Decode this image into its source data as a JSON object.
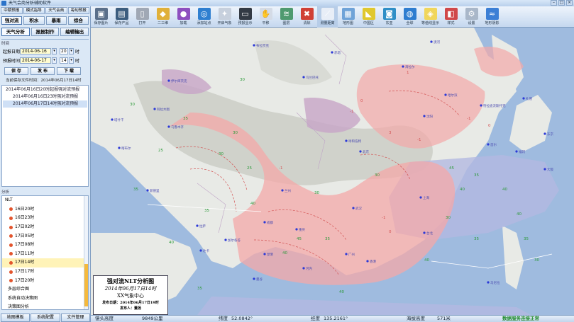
{
  "window": {
    "title": "天气会商分析辅助软件"
  },
  "left_panel": {
    "top_tabs": [
      "中期预报",
      "模式指导",
      "天气会商",
      "每旬预报"
    ],
    "mode_tabs": [
      "强对流",
      "积水",
      "暴雨",
      "综合"
    ],
    "sub_tabs": [
      "天气分析",
      "报报制作",
      "编辑输出"
    ],
    "time_group_label": "时间",
    "start_label": "起报日期",
    "start_date": "2014-06-16",
    "start_hour": "20",
    "hour_unit": "时",
    "forecast_label": "预报时间",
    "forecast_date": "2014-06-17",
    "forecast_hour": "14",
    "btn_save": "保 存",
    "btn_publish": "发 布",
    "btn_next": "下 载",
    "saved_line": "当前保存文件时间：2014年06月17日14时",
    "files": [
      {
        "text": "2014年06月16日20时起报强对流预报"
      },
      {
        "text": "2014年06月16日23时强对流预报"
      },
      {
        "text": "2014年06月17日14时强对流预报"
      }
    ],
    "analysis_label": "分析",
    "tree": [
      {
        "text": "NLT"
      },
      {
        "text": "16日20时",
        "color": "#e3542c"
      },
      {
        "text": "16日23时",
        "color": "#e3542c"
      },
      {
        "text": "17日02时",
        "color": "#e3542c"
      },
      {
        "text": "17日05时",
        "color": "#e3542c"
      },
      {
        "text": "17日08时",
        "color": "#e3542c"
      },
      {
        "text": "17日11时",
        "color": "#e3542c"
      },
      {
        "text": "17日14时",
        "color": "#e3542c"
      },
      {
        "text": "17日17时",
        "color": "#e3542c"
      },
      {
        "text": "17日20时",
        "color": "#e3542c"
      },
      {
        "text": "多层综合图"
      },
      {
        "text": "系统自动决策图"
      },
      {
        "text": "决策图分析"
      }
    ],
    "bottom_tabs": [
      "地图模板",
      "系统配置",
      "文件管理"
    ]
  },
  "toolbar": [
    {
      "label": "保存图片",
      "icon": "save-image-icon",
      "color": "#5a6f8a",
      "glyph": "▣"
    },
    {
      "label": "保存产品",
      "icon": "save-product-icon",
      "color": "#3c5d7e",
      "glyph": "▤"
    },
    {
      "label": "打开",
      "icon": "open-icon",
      "color": "#a0a8b5",
      "glyph": "▯"
    },
    {
      "label": "二三维",
      "icon": "2d3d-icon",
      "color": "#e0b03a",
      "glyph": "◆"
    },
    {
      "label": "加载",
      "icon": "load-icon",
      "color": "#8e4fbf",
      "glyph": "●"
    },
    {
      "label": "添加站点",
      "icon": "globe-icon",
      "color": "#2f7fd0",
      "glyph": "◎"
    },
    {
      "label": "开启气象",
      "icon": "bulb-icon",
      "color": "#c7d0dd",
      "glyph": "✦"
    },
    {
      "label": "预报显示",
      "icon": "monitor-icon",
      "color": "#333a44",
      "glyph": "▭"
    },
    {
      "label": "平移",
      "icon": "hand-icon",
      "color": "#d4dbe6",
      "glyph": "✋"
    },
    {
      "label": "图层",
      "icon": "layers-icon",
      "color": "#4f9a6f",
      "glyph": "≋"
    },
    {
      "label": "清除",
      "icon": "delete-icon",
      "color": "#d04035",
      "glyph": "✖"
    },
    {
      "label": "测量距离",
      "icon": "measure-icon",
      "color": "#e8eef7",
      "glyph": "⟋"
    },
    {
      "label": "地形图",
      "icon": "terrain-icon",
      "color": "#6fa3d8",
      "glyph": "▦"
    },
    {
      "label": "中国区",
      "icon": "china-region-icon",
      "color": "#e0c82e",
      "glyph": "◣"
    },
    {
      "label": "东亚",
      "icon": "east-asia-icon",
      "color": "#2f8fc7",
      "glyph": "◙"
    },
    {
      "label": "全球",
      "icon": "world-icon",
      "color": "#2e7dd0",
      "glyph": "◍"
    },
    {
      "label": "等值线显示",
      "icon": "contour-icon",
      "color": "#f0d65c",
      "glyph": "◈"
    },
    {
      "label": "样式",
      "icon": "style-icon",
      "color": "#d0484a",
      "glyph": "◧"
    },
    {
      "label": "设置",
      "icon": "settings-icon",
      "color": "#a9b7c9",
      "glyph": "⚙"
    },
    {
      "label": "地形阴影",
      "icon": "shadow-icon",
      "color": "#3c7fd5",
      "glyph": "≈"
    }
  ],
  "map": {
    "station_labels": [
      "伊尔库茨克",
      "乌兰巴托",
      "北京",
      "上海",
      "东京",
      "首尔",
      "沈阳",
      "哈尔滨",
      "呼和浩特",
      "兰州",
      "成都",
      "重庆",
      "武汉",
      "广州",
      "香港",
      "昆明",
      "拉萨",
      "乌鲁木齐",
      "台北",
      "马尼拉",
      "河内",
      "曼谷",
      "达卡",
      "加尔各答",
      "新德里",
      "喀布尔",
      "阿拉木图",
      "塔什干",
      "布拉茨克",
      "赤塔",
      "海拉尔",
      "漠河",
      "符拉迪沃斯托克",
      "札幌",
      "福冈",
      "大阪"
    ],
    "contour_values": [
      "30",
      "35",
      "40",
      "30",
      "-1",
      "0",
      "1",
      "3",
      "-1",
      "30",
      "35",
      "40",
      "45",
      "-1",
      "0",
      "40",
      "35",
      "30",
      "25",
      "40",
      "35",
      "-1",
      "30",
      "35",
      "40",
      "35",
      "30",
      "40",
      "45",
      "40",
      "35",
      "30",
      "25",
      "30",
      "35",
      "40",
      "-1",
      "0"
    ],
    "colors": {
      "ocean": "#9fbbdf",
      "land": "#e8eae6",
      "mountain": "#c9ccc4",
      "risk": "#f4a8a8",
      "risk_border": "#e06a6a",
      "purple": "#c7a5c7",
      "station": "#2b39d8",
      "contour": "#d35454",
      "green_text": "#2c9a3a"
    }
  },
  "legend": {
    "title": "强对流NLT分析图",
    "time": "2014年06月17日14时",
    "org": "XX气象中心",
    "publish_date": "发布日期：2014年06月17日19时",
    "publisher": "发布人：董扬"
  },
  "status": {
    "elev_label": "镜头高度",
    "elev_value": "9849公里",
    "lat_label": "纬度",
    "lat_value": "52.0842°",
    "lon_label": "经度",
    "lon_value": "135.2161°",
    "alt_label": "海拔高度",
    "alt_value": "571米",
    "conn": "数据服务连接正常"
  }
}
